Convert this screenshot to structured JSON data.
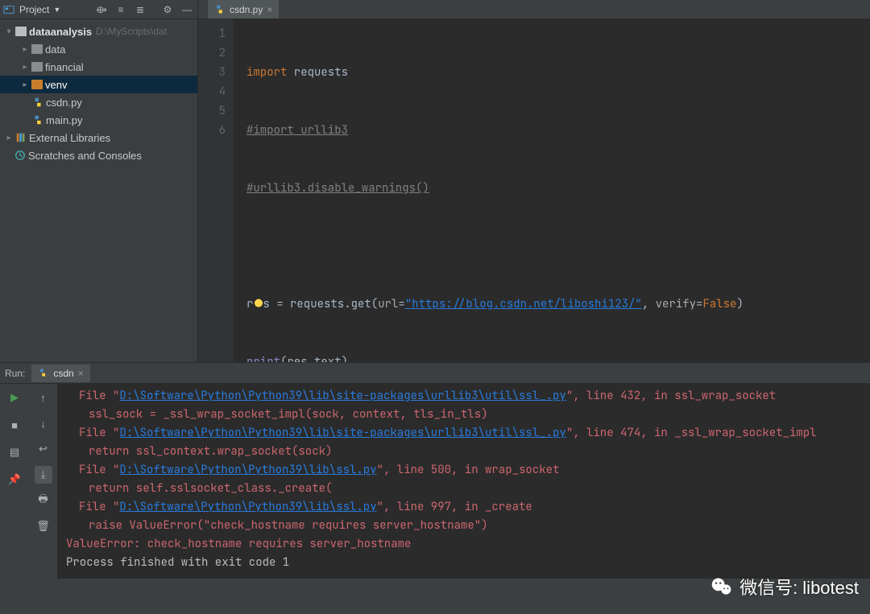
{
  "project": {
    "toolbar_label": "Project",
    "root_name": "dataanalysis",
    "root_path": "D:\\MyScripts\\dat",
    "children": [
      {
        "name": "data"
      },
      {
        "name": "financial"
      },
      {
        "name": "venv"
      },
      {
        "name": "csdn.py"
      },
      {
        "name": "main.py"
      }
    ],
    "external": "External Libraries",
    "scratches": "Scratches and Consoles"
  },
  "editor": {
    "tab_name": "csdn.py",
    "lines": [
      "1",
      "2",
      "3",
      "4",
      "5",
      "6"
    ],
    "code": {
      "l1": {
        "a": "import",
        "b": " requests"
      },
      "l2": "#import urllib3",
      "l3": "#urllib3.disable_warnings()",
      "l5": {
        "a": "r",
        "b": "s = requests.get(",
        "p1": "url",
        "eq1": "=",
        "u": "\"https://blog.csdn.net/liboshi123/\"",
        "c": ", ",
        "p2": "verify",
        "eq2": "=",
        "f": "False",
        "d": ")"
      },
      "l6": {
        "a": "print",
        "b": "(res.text",
        "c": ")"
      }
    }
  },
  "run": {
    "label": "Run:",
    "tab": "csdn",
    "lines": [
      {
        "indent": 16,
        "segs": [
          {
            "t": "File ",
            "c": "p"
          },
          {
            "t": "\"",
            "c": "p"
          },
          {
            "t": "D:\\Software\\Python\\Python39\\lib\\site-packages\\urllib3\\util\\ssl_.py",
            "c": "path"
          },
          {
            "t": "\", line 432, in ssl_wrap_socket",
            "c": "p"
          }
        ]
      },
      {
        "indent": 28,
        "segs": [
          {
            "t": "ssl_sock = _ssl_wrap_socket_impl(sock, context, tls_in_tls)",
            "c": "p"
          }
        ]
      },
      {
        "indent": 16,
        "segs": [
          {
            "t": "File ",
            "c": "p"
          },
          {
            "t": "\"",
            "c": "p"
          },
          {
            "t": "D:\\Software\\Python\\Python39\\lib\\site-packages\\urllib3\\util\\ssl_.py",
            "c": "path"
          },
          {
            "t": "\", line 474, in _ssl_wrap_socket_impl",
            "c": "p"
          }
        ]
      },
      {
        "indent": 28,
        "segs": [
          {
            "t": "return ssl_context.wrap_socket(sock)",
            "c": "p"
          }
        ]
      },
      {
        "indent": 16,
        "segs": [
          {
            "t": "File ",
            "c": "p"
          },
          {
            "t": "\"",
            "c": "p"
          },
          {
            "t": "D:\\Software\\Python\\Python39\\lib\\ssl.py",
            "c": "path"
          },
          {
            "t": "\", line 500, in wrap_socket",
            "c": "p"
          }
        ]
      },
      {
        "indent": 28,
        "segs": [
          {
            "t": "return self.sslsocket_class._create(",
            "c": "p"
          }
        ]
      },
      {
        "indent": 16,
        "segs": [
          {
            "t": "File ",
            "c": "p"
          },
          {
            "t": "\"",
            "c": "p"
          },
          {
            "t": "D:\\Software\\Python\\Python39\\lib\\ssl.py",
            "c": "path"
          },
          {
            "t": "\", line 997, in _create",
            "c": "p"
          }
        ]
      },
      {
        "indent": 28,
        "segs": [
          {
            "t": "raise ValueError(\"check_hostname requires server_hostname\")",
            "c": "p"
          }
        ]
      },
      {
        "indent": 0,
        "segs": [
          {
            "t": "ValueError: check_hostname requires server_hostname",
            "c": "p"
          }
        ]
      },
      {
        "indent": 0,
        "segs": [
          {
            "t": "",
            "c": "plain"
          }
        ]
      },
      {
        "indent": 0,
        "segs": [
          {
            "t": "Process finished with exit code 1",
            "c": "plain"
          }
        ]
      }
    ]
  },
  "watermark": {
    "label": "微信号: libotest"
  }
}
